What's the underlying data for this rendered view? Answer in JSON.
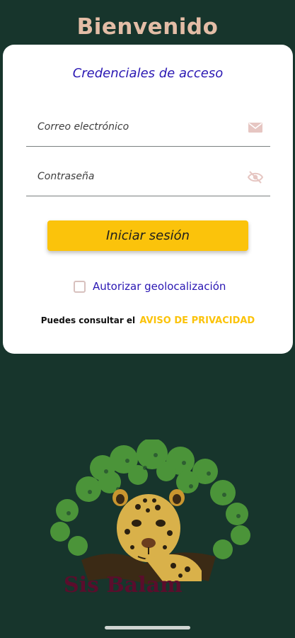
{
  "header": {
    "title": "Bienvenido"
  },
  "login_card": {
    "title": "Credenciales de acceso",
    "email_placeholder": "Correo electrónico",
    "password_placeholder": "Contraseña",
    "login_button": "Iniciar sesión",
    "geolocation_label": "Autorizar geolocalización",
    "geolocation_checked": false,
    "privacy_text": "Puedes consultar el",
    "privacy_link": "AVISO DE PRIVACIDAD"
  },
  "logo": {
    "text": "Sis Balam"
  },
  "icons": {
    "email": "mail-icon",
    "password_visibility": "eye-off-icon",
    "logo": "jaguar-tree-logo"
  },
  "colors": {
    "background": "#17352c",
    "title": "#e3bda6",
    "accent_button": "#fbc30b",
    "link_blue": "#2a17b3",
    "icon_pink": "#e6c6c2"
  }
}
